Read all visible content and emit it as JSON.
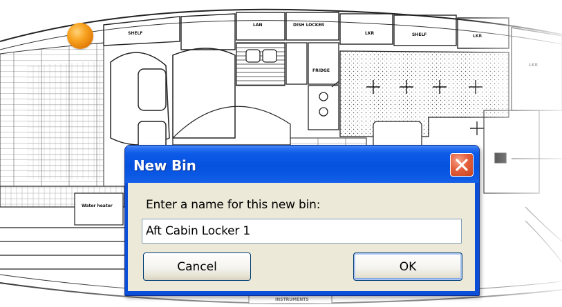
{
  "floorplan": {
    "labels": [
      "LAN",
      "DISH LOCKER",
      "SHELF",
      "LKR",
      "SHELF",
      "LKR",
      "LKR",
      "FRIDGE",
      "INSTRUMENTS"
    ],
    "marker_color": "#f39419"
  },
  "dialog": {
    "title": "New Bin",
    "prompt": "Enter a name for this new bin:",
    "input_value": "Aft Cabin Locker 1",
    "cancel_label": "Cancel",
    "ok_label": "OK",
    "close_icon": "close-x-icon",
    "colors": {
      "titlebar": "#0a5ae3",
      "client_bg": "#ece9d8",
      "close_button": "#d9532f"
    }
  }
}
